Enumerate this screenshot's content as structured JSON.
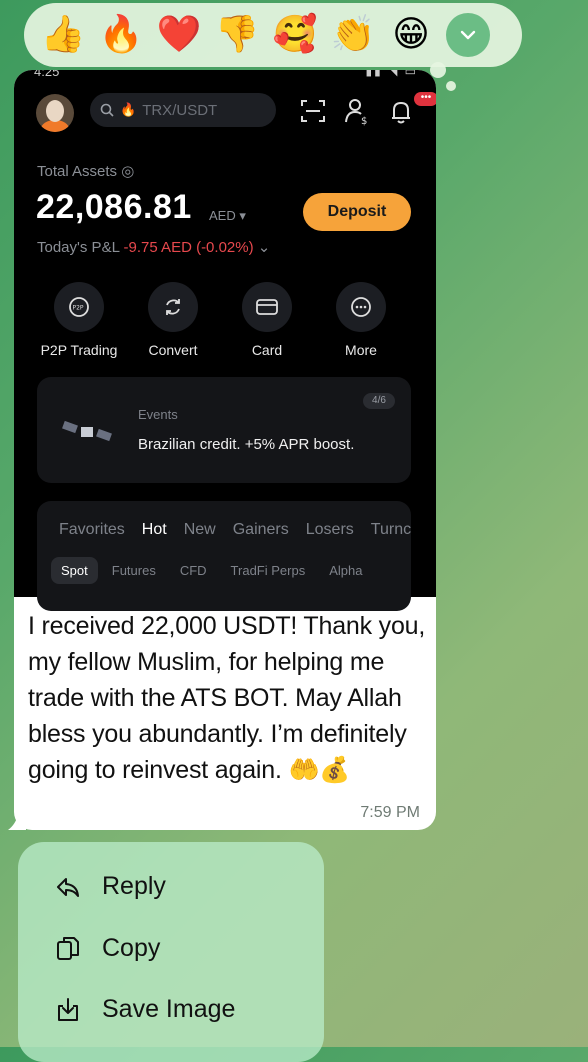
{
  "reactions": {
    "items": [
      {
        "name": "thumbs-up",
        "glyph": "👍"
      },
      {
        "name": "fire",
        "glyph": "🔥"
      },
      {
        "name": "heart",
        "glyph": "❤️"
      },
      {
        "name": "thumbs-down",
        "glyph": "👎"
      },
      {
        "name": "smiling-face-with-hearts",
        "glyph": "🥰"
      },
      {
        "name": "clapping-hands",
        "glyph": "👏"
      },
      {
        "name": "grinning-face",
        "glyph": "😁"
      }
    ],
    "more_icon": "chevron-down-icon"
  },
  "screenshot": {
    "search_placeholder": "TRX/USDT",
    "total_assets_label": "Total Assets",
    "balance": "22,086.81",
    "balance_currency": "AED ▾",
    "pnl_label": "Today's P&L",
    "pnl_value": "-9.75 AED (-0.02%)",
    "deposit_label": "Deposit",
    "notification_badge": "•••",
    "quick_actions": [
      {
        "label": "P2P Trading",
        "icon": "p2p-icon"
      },
      {
        "label": "Convert",
        "icon": "convert-icon"
      },
      {
        "label": "Card",
        "icon": "card-icon"
      },
      {
        "label": "More",
        "icon": "more-icon"
      }
    ],
    "events": {
      "label": "Events",
      "text": "Brazilian credit. +5% APR boost.",
      "page": "4/6"
    },
    "market_tabs": [
      "Favorites",
      "Hot",
      "New",
      "Gainers",
      "Losers",
      "Turnc"
    ],
    "market_tab_active": "Hot",
    "market_subtabs": [
      "Spot",
      "Futures",
      "CFD",
      "TradFi Perps",
      "Alpha"
    ],
    "market_subtab_active": "Spot"
  },
  "message": {
    "text": "I received 22,000 USDT! Thank you, my fellow Muslim, for helping me trade with the ATS BOT. May Allah bless you abundantly. I’m definitely going to reinvest again. 🤲💰",
    "time": "7:59 PM"
  },
  "context_menu": {
    "items": [
      {
        "label": "Reply",
        "icon": "reply-icon"
      },
      {
        "label": "Copy",
        "icon": "copy-icon"
      },
      {
        "label": "Save Image",
        "icon": "save-image-icon"
      }
    ]
  },
  "colors": {
    "accent_orange": "#f6a33a",
    "negative_red": "#e6484d",
    "chat_green": "#58a86a"
  }
}
